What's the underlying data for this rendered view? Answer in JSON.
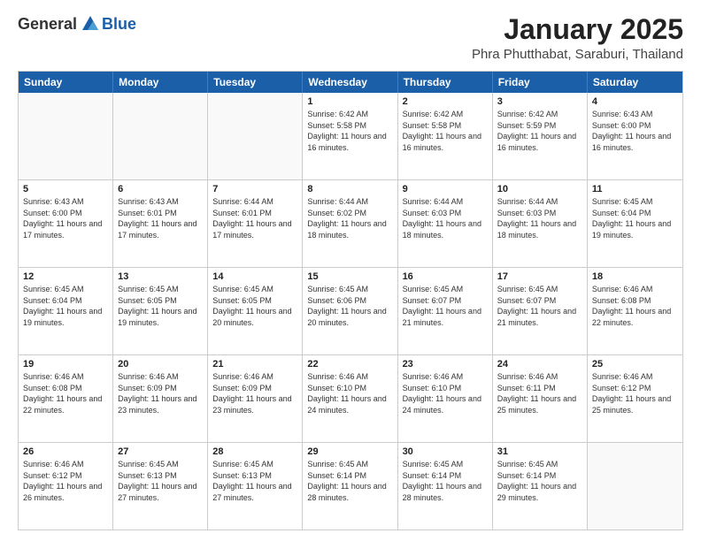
{
  "logo": {
    "general": "General",
    "blue": "Blue"
  },
  "title": "January 2025",
  "location": "Phra Phutthabat, Saraburi, Thailand",
  "weekdays": [
    "Sunday",
    "Monday",
    "Tuesday",
    "Wednesday",
    "Thursday",
    "Friday",
    "Saturday"
  ],
  "rows": [
    [
      {
        "day": "",
        "info": "",
        "empty": true
      },
      {
        "day": "",
        "info": "",
        "empty": true
      },
      {
        "day": "",
        "info": "",
        "empty": true
      },
      {
        "day": "1",
        "info": "Sunrise: 6:42 AM\nSunset: 5:58 PM\nDaylight: 11 hours and 16 minutes."
      },
      {
        "day": "2",
        "info": "Sunrise: 6:42 AM\nSunset: 5:58 PM\nDaylight: 11 hours and 16 minutes."
      },
      {
        "day": "3",
        "info": "Sunrise: 6:42 AM\nSunset: 5:59 PM\nDaylight: 11 hours and 16 minutes."
      },
      {
        "day": "4",
        "info": "Sunrise: 6:43 AM\nSunset: 6:00 PM\nDaylight: 11 hours and 16 minutes."
      }
    ],
    [
      {
        "day": "5",
        "info": "Sunrise: 6:43 AM\nSunset: 6:00 PM\nDaylight: 11 hours and 17 minutes."
      },
      {
        "day": "6",
        "info": "Sunrise: 6:43 AM\nSunset: 6:01 PM\nDaylight: 11 hours and 17 minutes."
      },
      {
        "day": "7",
        "info": "Sunrise: 6:44 AM\nSunset: 6:01 PM\nDaylight: 11 hours and 17 minutes."
      },
      {
        "day": "8",
        "info": "Sunrise: 6:44 AM\nSunset: 6:02 PM\nDaylight: 11 hours and 18 minutes."
      },
      {
        "day": "9",
        "info": "Sunrise: 6:44 AM\nSunset: 6:03 PM\nDaylight: 11 hours and 18 minutes."
      },
      {
        "day": "10",
        "info": "Sunrise: 6:44 AM\nSunset: 6:03 PM\nDaylight: 11 hours and 18 minutes."
      },
      {
        "day": "11",
        "info": "Sunrise: 6:45 AM\nSunset: 6:04 PM\nDaylight: 11 hours and 19 minutes."
      }
    ],
    [
      {
        "day": "12",
        "info": "Sunrise: 6:45 AM\nSunset: 6:04 PM\nDaylight: 11 hours and 19 minutes."
      },
      {
        "day": "13",
        "info": "Sunrise: 6:45 AM\nSunset: 6:05 PM\nDaylight: 11 hours and 19 minutes."
      },
      {
        "day": "14",
        "info": "Sunrise: 6:45 AM\nSunset: 6:05 PM\nDaylight: 11 hours and 20 minutes."
      },
      {
        "day": "15",
        "info": "Sunrise: 6:45 AM\nSunset: 6:06 PM\nDaylight: 11 hours and 20 minutes."
      },
      {
        "day": "16",
        "info": "Sunrise: 6:45 AM\nSunset: 6:07 PM\nDaylight: 11 hours and 21 minutes."
      },
      {
        "day": "17",
        "info": "Sunrise: 6:45 AM\nSunset: 6:07 PM\nDaylight: 11 hours and 21 minutes."
      },
      {
        "day": "18",
        "info": "Sunrise: 6:46 AM\nSunset: 6:08 PM\nDaylight: 11 hours and 22 minutes."
      }
    ],
    [
      {
        "day": "19",
        "info": "Sunrise: 6:46 AM\nSunset: 6:08 PM\nDaylight: 11 hours and 22 minutes."
      },
      {
        "day": "20",
        "info": "Sunrise: 6:46 AM\nSunset: 6:09 PM\nDaylight: 11 hours and 23 minutes."
      },
      {
        "day": "21",
        "info": "Sunrise: 6:46 AM\nSunset: 6:09 PM\nDaylight: 11 hours and 23 minutes."
      },
      {
        "day": "22",
        "info": "Sunrise: 6:46 AM\nSunset: 6:10 PM\nDaylight: 11 hours and 24 minutes."
      },
      {
        "day": "23",
        "info": "Sunrise: 6:46 AM\nSunset: 6:10 PM\nDaylight: 11 hours and 24 minutes."
      },
      {
        "day": "24",
        "info": "Sunrise: 6:46 AM\nSunset: 6:11 PM\nDaylight: 11 hours and 25 minutes."
      },
      {
        "day": "25",
        "info": "Sunrise: 6:46 AM\nSunset: 6:12 PM\nDaylight: 11 hours and 25 minutes."
      }
    ],
    [
      {
        "day": "26",
        "info": "Sunrise: 6:46 AM\nSunset: 6:12 PM\nDaylight: 11 hours and 26 minutes."
      },
      {
        "day": "27",
        "info": "Sunrise: 6:45 AM\nSunset: 6:13 PM\nDaylight: 11 hours and 27 minutes."
      },
      {
        "day": "28",
        "info": "Sunrise: 6:45 AM\nSunset: 6:13 PM\nDaylight: 11 hours and 27 minutes."
      },
      {
        "day": "29",
        "info": "Sunrise: 6:45 AM\nSunset: 6:14 PM\nDaylight: 11 hours and 28 minutes."
      },
      {
        "day": "30",
        "info": "Sunrise: 6:45 AM\nSunset: 6:14 PM\nDaylight: 11 hours and 28 minutes."
      },
      {
        "day": "31",
        "info": "Sunrise: 6:45 AM\nSunset: 6:14 PM\nDaylight: 11 hours and 29 minutes."
      },
      {
        "day": "",
        "info": "",
        "empty": true
      }
    ]
  ]
}
